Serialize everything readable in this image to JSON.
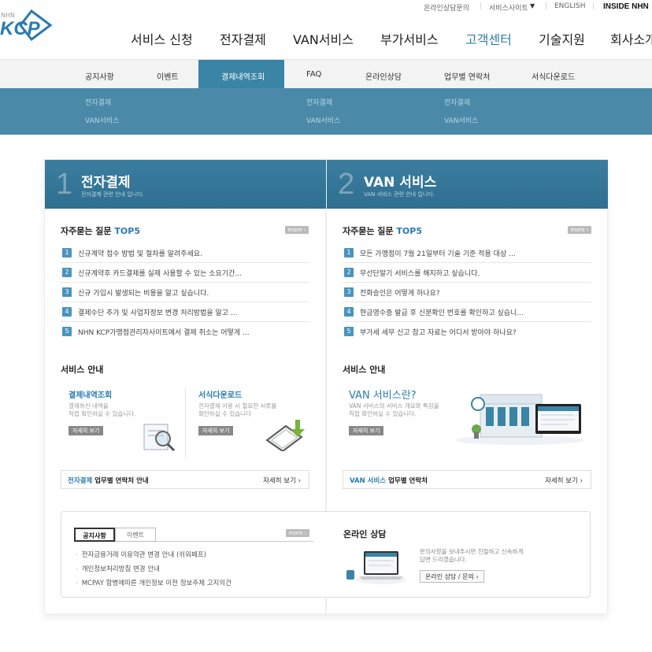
{
  "top_links": {
    "counsel": "온라인상담문의",
    "service_site": "서비스사이트",
    "english": "ENGLISH",
    "inside": "INSIDE NHN"
  },
  "logo": {
    "brand": "KCP",
    "tag": "NHN"
  },
  "gnb": [
    "서비스 신청",
    "전자결제",
    "VAN서비스",
    "부가서비스",
    "고객센터",
    "기술지원",
    "회사소개"
  ],
  "subnav": [
    "공지사항",
    "이벤트",
    "결제내역조회",
    "FAQ",
    "온라인상담",
    "업무별 연락처",
    "서식다운로드"
  ],
  "dropdown": {
    "col1": [
      "전자결제",
      "VAN서비스"
    ],
    "col2": [
      "전자결제",
      "VAN서비스"
    ],
    "col3": [
      "전자결제",
      "VAN서비스"
    ]
  },
  "left": {
    "num": "1",
    "title": "전자결제",
    "subtitle": "전자결제 관련 안내 입니다.",
    "faq_title": "자주묻는 질문",
    "faq_top": "TOP5",
    "more": "more ›",
    "faq": [
      "신규계약 접수 방법 및 절차를 알려주세요.",
      "신규계약후 카드결제를 실제 사용할 수 있는 소요기간...",
      "신규 가입시 발생되는 비용을 알고 싶습니다.",
      "결제수단 추가 및 사업자정보 변경 처리방법을 알고 ...",
      "NHN KCP가맹점관리자사이트에서 결제 취소는 어떻게 ..."
    ],
    "svc_title": "서비스 안내",
    "svc1": {
      "title": "결제내역조회",
      "desc1": "결제하신 내역을",
      "desc2": "직접 확인하실 수 있습니다.",
      "btn": "자세히 보기"
    },
    "svc2": {
      "title": "서식다운로드",
      "desc1": "전자결제 이용 시 필요한 서류를",
      "desc2": "확인하실 수 있습니다",
      "btn": "자세히 보기"
    },
    "link_strong": "전자결제",
    "link_rest": " 업무별 연락처 안내",
    "link_more": "자세히 보기 ›"
  },
  "right": {
    "num": "2",
    "title": "VAN 서비스",
    "subtitle": "VAN 서비스 관련 안내 입니다.",
    "faq_title": "자주묻는 질문",
    "faq_top": "TOP5",
    "more": "more ›",
    "faq": [
      "모든 가맹점이 7월 21일부터 기술 기준 적용 대상 ...",
      "무선단말기 서비스를 해지하고 싶습니다.",
      "전화승인은 어떻게 하나요?",
      "현금영수증 발급 후 신분확인 번호를 확인하고 싶습니...",
      "부가세 세무 신고 참고 자료는 어디서 받아야 하나요?"
    ],
    "svc_title": "서비스 안내",
    "svc1": {
      "title": "VAN 서비스란?",
      "desc1": "VAN 서비스의 서비스 개요와 특징을",
      "desc2": "직접 확인하실 수 있습니다.",
      "btn": "자세히 보기"
    },
    "link_strong": "VAN 서비스",
    "link_rest": " 업무별 연락처",
    "link_more": "자세히 보기 ›"
  },
  "notice": {
    "tab_on": "공지사항",
    "tab_off": "이벤트",
    "more": "more ›",
    "items": [
      "전자금융거래 이용약관 변경 안내 (쉬워페프)",
      "개인정보처리방침 변경 안내",
      "MCPAY 합병에따른 개인정보 이전 정보주체 고지의건"
    ]
  },
  "online": {
    "title": "온라인 상담",
    "desc1": "문의사항을 보내주시면 친절하고 신속하게",
    "desc2": "답변 드리겠습니다.",
    "btn": "온라인 상담 / 문의 ›"
  },
  "colors": {
    "accent": "#3a84a6",
    "header": "#2f6f90",
    "blue_text": "#2a7bb0"
  }
}
